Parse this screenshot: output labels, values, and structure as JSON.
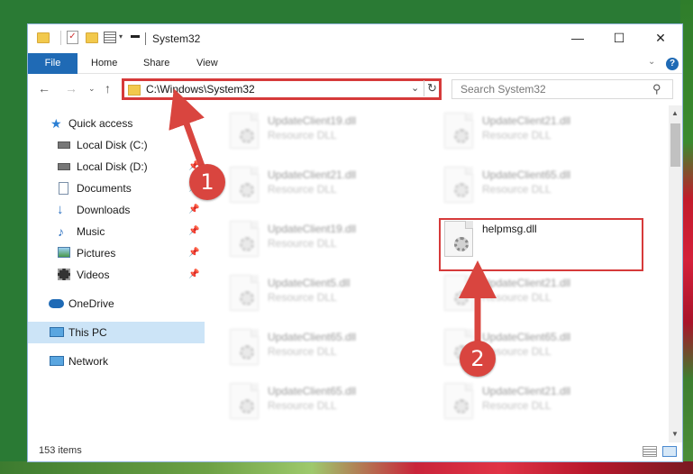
{
  "window": {
    "title": "System32"
  },
  "ribbon": {
    "file_label": "File",
    "tabs": [
      "Home",
      "Share",
      "View"
    ],
    "help_label": "?"
  },
  "address_bar": {
    "path": "C:\\Windows\\System32",
    "search_placeholder": "Search System32"
  },
  "nav_pane": {
    "items": [
      {
        "label": "Quick access",
        "icon": "star-icon"
      },
      {
        "label": "Local Disk (C:)",
        "icon": "drive-icon"
      },
      {
        "label": "Local Disk (D:)",
        "icon": "drive-icon"
      },
      {
        "label": "Documents",
        "icon": "documents-icon"
      },
      {
        "label": "Downloads",
        "icon": "download-icon"
      },
      {
        "label": "Music",
        "icon": "music-icon"
      },
      {
        "label": "Pictures",
        "icon": "pictures-icon"
      },
      {
        "label": "Videos",
        "icon": "videos-icon"
      },
      {
        "label": "OneDrive",
        "icon": "cloud-icon"
      },
      {
        "label": "This PC",
        "icon": "computer-icon"
      },
      {
        "label": "Network",
        "icon": "network-icon"
      }
    ],
    "selected": "This PC"
  },
  "files": {
    "left_column": [
      {
        "name": "UpdateClient19.dll",
        "type": "Resource DLL"
      },
      {
        "name": "UpdateClient21.dll",
        "type": "Resource DLL"
      },
      {
        "name": "UpdateClient19.dll",
        "type": "Resource DLL"
      },
      {
        "name": "UpdateClient5.dll",
        "type": "Resource DLL"
      },
      {
        "name": "UpdateClient65.dll",
        "type": "Resource DLL"
      },
      {
        "name": "UpdateClient65.dll",
        "type": "Resource DLL"
      }
    ],
    "right_column": [
      {
        "name": "UpdateClient21.dll",
        "type": "Resource DLL"
      },
      {
        "name": "UpdateClient65.dll",
        "type": "Resource DLL"
      },
      {
        "name": "helpmsg.dll",
        "type": ""
      },
      {
        "name": "UpdateClient21.dll",
        "type": "Resource DLL"
      },
      {
        "name": "UpdateClient65.dll",
        "type": "Resource DLL"
      },
      {
        "name": "UpdateClient21.dll",
        "type": "Resource DLL"
      }
    ]
  },
  "status": {
    "item_count": "153 items"
  },
  "callouts": {
    "one": "1",
    "two": "2"
  },
  "colors": {
    "accent": "#1f6ab5",
    "highlight": "#d63a3a",
    "callout": "#d9453f"
  }
}
